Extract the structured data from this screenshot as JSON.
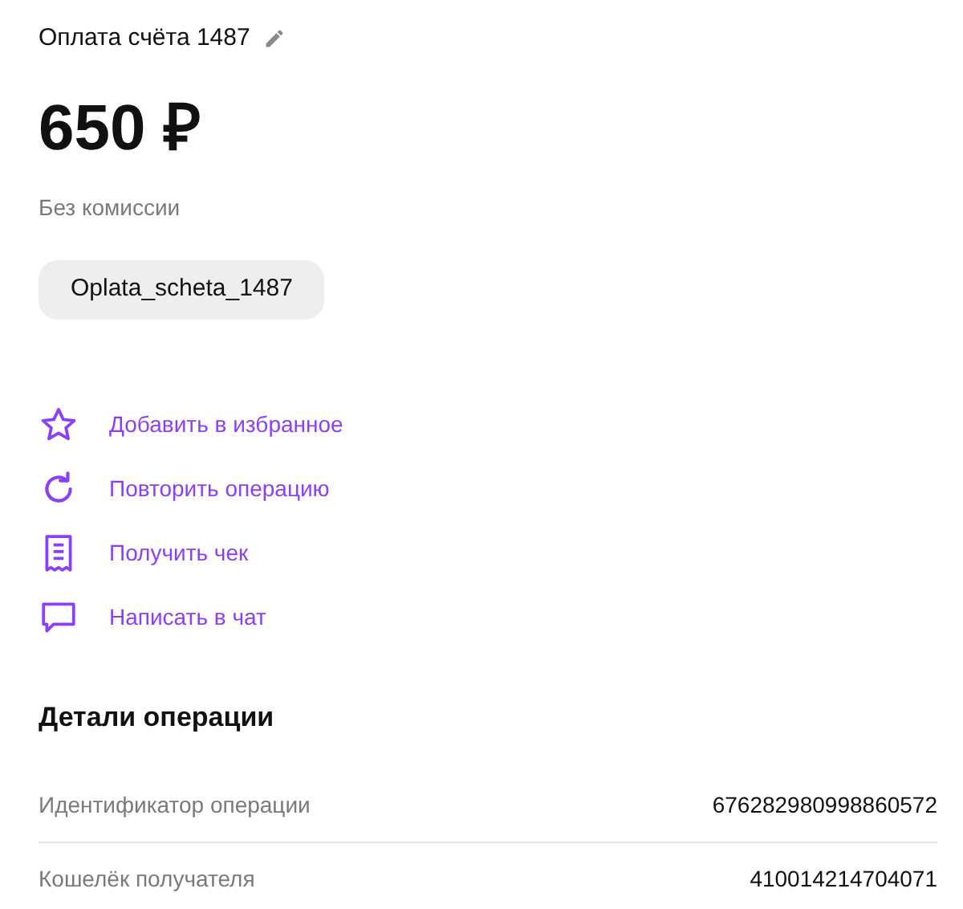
{
  "header": {
    "title": "Оплата счёта 1487"
  },
  "amount": "650 ₽",
  "commission": "Без комиссии",
  "tag": "Oplata_scheta_1487",
  "actions": [
    {
      "kind": "star",
      "label": "Добавить в избранное"
    },
    {
      "kind": "repeat",
      "label": "Повторить операцию"
    },
    {
      "kind": "receipt",
      "label": "Получить чек"
    },
    {
      "kind": "chat",
      "label": "Написать в чат"
    }
  ],
  "details": {
    "title": "Детали операции",
    "rows": [
      {
        "label": "Идентификатор операции",
        "value": "676282980998860572"
      },
      {
        "label": "Кошелёк получателя",
        "value": "410014214704071"
      }
    ]
  }
}
